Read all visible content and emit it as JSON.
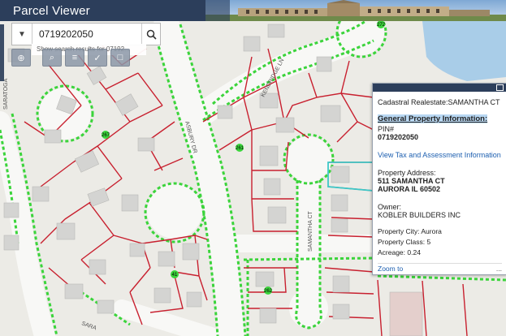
{
  "header": {
    "title": "Parcel Viewer"
  },
  "search": {
    "value": "0719202050",
    "suggestion": "Show search results for 07192..."
  },
  "tools": [
    {
      "name": "locate",
      "glyph": "⊕"
    },
    {
      "name": "zoom",
      "glyph": "⌕"
    },
    {
      "name": "layers",
      "glyph": "≡"
    },
    {
      "name": "measure",
      "glyph": "✓"
    },
    {
      "name": "print",
      "glyph": "□"
    }
  ],
  "map": {
    "streets": {
      "asbury": "ASBURY DR",
      "kendridge": "KENDRIDGE LN",
      "samantha": "SAMANTHA CT",
      "saratoga_top": "SARATOGA",
      "saratoga_bottom": "SARA"
    },
    "parcel_numbers": [
      "267",
      "261",
      "272",
      "262",
      "41"
    ]
  },
  "popup": {
    "title": "Cadastral Realestate:SAMANTHA CT",
    "general": "General Property Information:",
    "pin_label": "PIN#",
    "pin": "0719202050",
    "tax_link": "View Tax and Assessment Information",
    "addr_label": "Property Address:",
    "addr1": "511 SAMANTHA CT",
    "addr2": "AURORA IL 60502",
    "owner_label": "Owner:",
    "owner": "KOBLER BUILDERS INC",
    "city": "Property City:  Aurora",
    "class": "Property Class: 5",
    "acreage": "Acreage:       0.24",
    "zoom": "Zoom to",
    "more": "..."
  },
  "colors": {
    "header": "#2c3e5b",
    "parcel": "#c8202f",
    "highlight": "#3ec8c8",
    "road": "#f7f7f5",
    "green": "#3bd43b"
  }
}
